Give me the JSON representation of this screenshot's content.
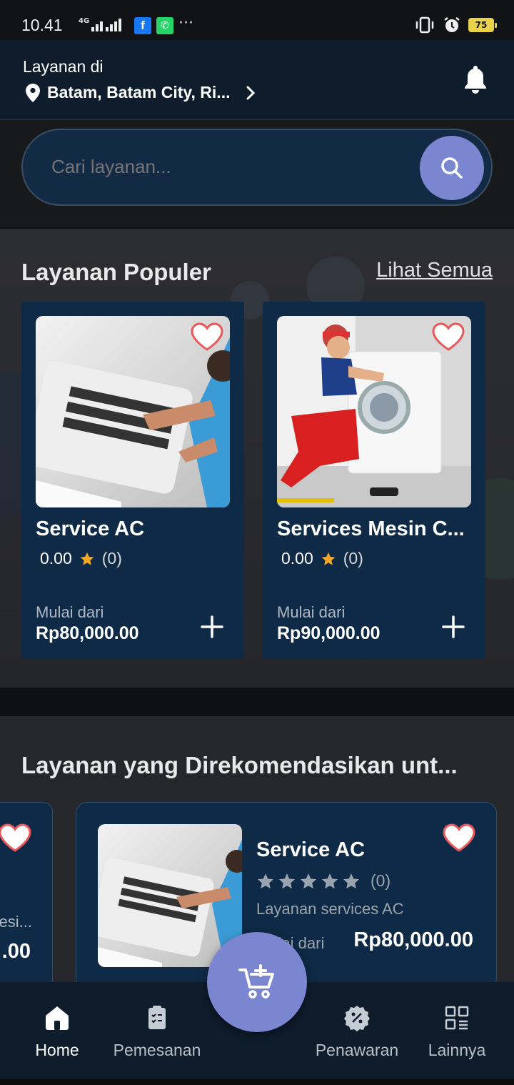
{
  "status_bar": {
    "time": "10.41",
    "network": "4G",
    "battery": "75"
  },
  "header": {
    "label": "Layanan di",
    "location": "Batam, Batam City, Ri..."
  },
  "search": {
    "placeholder": "Cari layanan..."
  },
  "popular": {
    "title": "Layanan Populer",
    "see_all": "Lihat Semua",
    "items": [
      {
        "name": "Service AC",
        "rating": "0.00",
        "reviews": "(0)",
        "from_label": "Mulai dari",
        "price": "Rp80,000.00"
      },
      {
        "name": "Services Mesin C...",
        "rating": "0.00",
        "reviews": "(0)",
        "from_label": "Mulai dari",
        "price": "Rp90,000.00"
      }
    ]
  },
  "recommended": {
    "title": "Layanan yang Direkomendasikan unt...",
    "partial_card": {
      "name_fragment": "esi...",
      "price_fragment": ".00"
    },
    "items": [
      {
        "name": "Service AC",
        "reviews": "(0)",
        "description": "Layanan services AC",
        "from_label": "Mulai dari",
        "price": "Rp80,000.00"
      }
    ]
  },
  "bottom_nav": {
    "items": [
      {
        "label": "Home",
        "icon": "home-icon"
      },
      {
        "label": "Pemesanan",
        "icon": "clipboard-icon"
      },
      {
        "label": "Penawaran",
        "icon": "discount-badge-icon"
      },
      {
        "label": "Lainnya",
        "icon": "grid-list-icon"
      }
    ],
    "fab_icon": "cart-add-icon"
  },
  "colors": {
    "accent": "#7b86d0",
    "card": "#0f2a46",
    "header": "#0e1c2c",
    "star": "#f5a623",
    "heart": "#ff5a5f"
  }
}
